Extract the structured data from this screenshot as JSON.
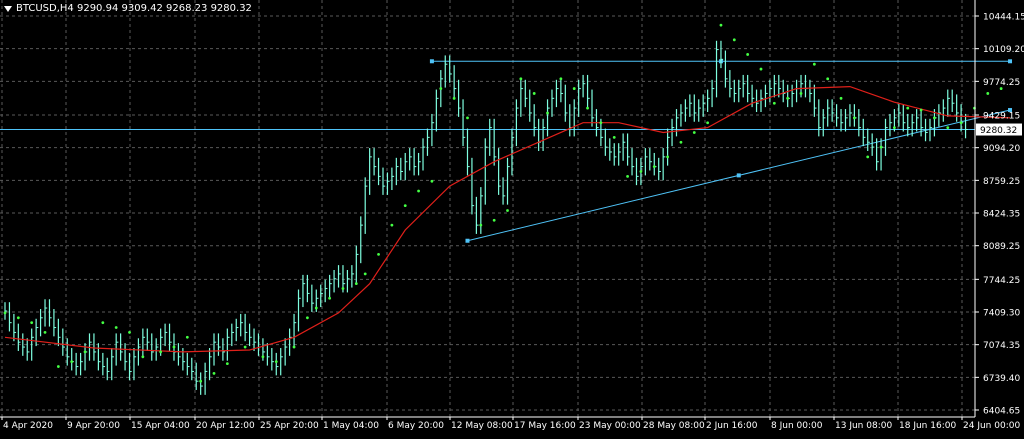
{
  "header": {
    "symbol_line": "BTCUSD,H4  9290.94 9309.42 9268.23 9280.32"
  },
  "colors": {
    "background": "#000000",
    "grid": "#5a5a5a",
    "candles": "#7fffe0",
    "moving_average": "#e0201a",
    "parabolic_sar": "#44ff44",
    "trendline": "#4fc3f7",
    "price_line": "#4fc3f7",
    "axis_text": "#ffffff"
  },
  "chart_data": {
    "type": "line",
    "title": "",
    "symbol": "BTCUSD",
    "timeframe": "H4",
    "ohlc_last": {
      "open": 9290.94,
      "high": 9309.42,
      "low": 9268.23,
      "close": 9280.32
    },
    "current_price_label": "9280.32",
    "ylim": [
      6404.65,
      10600
    ],
    "y_ticks": [
      "10444.15",
      "10109.20",
      "9774.25",
      "9429.15",
      "9094.20",
      "8759.25",
      "8424.35",
      "8089.25",
      "7744.25",
      "7409.30",
      "7074.35",
      "6739.40",
      "6404.65"
    ],
    "x_ticks": [
      "4 Apr 2020",
      "9 Apr 20:00",
      "15 Apr 04:00",
      "20 Apr 12:00",
      "25 Apr 20:00",
      "1 May 04:00",
      "6 May 20:00",
      "12 May 08:00",
      "17 May 16:00",
      "23 May 00:00",
      "28 May 08:00",
      "2 Jun 16:00",
      "8 Jun 00:00",
      "13 Jun 08:00",
      "18 Jun 16:00",
      "24 Jun 00:00"
    ],
    "price_close": [
      7420,
      7300,
      7200,
      7100,
      7050,
      7000,
      7150,
      7250,
      7350,
      7450,
      7350,
      7250,
      7150,
      7050,
      6950,
      6900,
      6850,
      6900,
      7000,
      7100,
      7000,
      6900,
      6850,
      6800,
      6950,
      7100,
      7000,
      6900,
      6800,
      6950,
      7050,
      7150,
      7100,
      7000,
      7050,
      7150,
      7200,
      7100,
      7000,
      6950,
      6900,
      6850,
      6800,
      6700,
      6650,
      6800,
      6950,
      7100,
      7050,
      7000,
      7150,
      7200,
      7250,
      7300,
      7200,
      7150,
      7100,
      7050,
      7000,
      6950,
      6900,
      6850,
      6950,
      7050,
      7150,
      7300,
      7550,
      7700,
      7600,
      7500,
      7550,
      7600,
      7650,
      7700,
      7750,
      7800,
      7700,
      7750,
      7800,
      8000,
      8300,
      8700,
      9000,
      8900,
      8800,
      8700,
      8750,
      8800,
      8900,
      8850,
      8950,
      9000,
      8900,
      8950,
      9100,
      9200,
      9350,
      9600,
      9800,
      9950,
      9850,
      9700,
      9500,
      9200,
      8900,
      8500,
      8300,
      8600,
      9100,
      9300,
      9000,
      8700,
      8600,
      8900,
      9200,
      9500,
      9700,
      9600,
      9450,
      9300,
      9150,
      9300,
      9500,
      9600,
      9700,
      9650,
      9450,
      9300,
      9500,
      9700,
      9750,
      9600,
      9400,
      9300,
      9200,
      9100,
      9050,
      9000,
      9050,
      9150,
      9000,
      8900,
      8800,
      8900,
      9000,
      8950,
      8900,
      8850,
      9000,
      9200,
      9300,
      9400,
      9450,
      9500,
      9550,
      9450,
      9500,
      9550,
      9600,
      9700,
      10100,
      10000,
      9800,
      9700,
      9650,
      9700,
      9750,
      9650,
      9600,
      9550,
      9600,
      9650,
      9700,
      9750,
      9700,
      9650,
      9600,
      9650,
      9700,
      9750,
      9700,
      9650,
      9500,
      9300,
      9400,
      9500,
      9450,
      9400,
      9350,
      9400,
      9450,
      9400,
      9300,
      9200,
      9150,
      9100,
      8950,
      9100,
      9300,
      9350,
      9400,
      9450,
      9350,
      9300,
      9350,
      9400,
      9300,
      9250,
      9300,
      9400,
      9450,
      9500,
      9600,
      9550,
      9450,
      9350,
      9280.32
    ],
    "moving_average": {
      "name": "",
      "values": [
        [
          0,
          7150
        ],
        [
          20,
          7040
        ],
        [
          40,
          7000
        ],
        [
          55,
          7020
        ],
        [
          65,
          7150
        ],
        [
          75,
          7400
        ],
        [
          82,
          7700
        ],
        [
          90,
          8250
        ],
        [
          100,
          8700
        ],
        [
          110,
          8950
        ],
        [
          120,
          9150
        ],
        [
          130,
          9350
        ],
        [
          138,
          9350
        ],
        [
          148,
          9250
        ],
        [
          158,
          9300
        ],
        [
          168,
          9550
        ],
        [
          178,
          9700
        ],
        [
          190,
          9720
        ],
        [
          200,
          9560
        ],
        [
          212,
          9420
        ],
        [
          226,
          9400
        ]
      ]
    },
    "parabolic_sar": {
      "name": "",
      "values": [
        [
          0,
          7400
        ],
        [
          3,
          7350
        ],
        [
          6,
          7300
        ],
        [
          9,
          7200
        ],
        [
          12,
          6850
        ],
        [
          15,
          6900
        ],
        [
          18,
          7000
        ],
        [
          22,
          7300
        ],
        [
          25,
          7250
        ],
        [
          28,
          7200
        ],
        [
          31,
          6950
        ],
        [
          35,
          7000
        ],
        [
          38,
          7050
        ],
        [
          41,
          7150
        ],
        [
          44,
          6700
        ],
        [
          47,
          6780
        ],
        [
          50,
          6880
        ],
        [
          54,
          7050
        ],
        [
          58,
          6950
        ],
        [
          61,
          6900
        ],
        [
          65,
          7050
        ],
        [
          68,
          7350
        ],
        [
          70,
          7450
        ],
        [
          73,
          7550
        ],
        [
          76,
          7650
        ],
        [
          79,
          7700
        ],
        [
          81,
          7800
        ],
        [
          84,
          8000
        ],
        [
          87,
          8300
        ],
        [
          90,
          8500
        ],
        [
          93,
          8650
        ],
        [
          96,
          8750
        ],
        [
          98,
          9700
        ],
        [
          101,
          9600
        ],
        [
          104,
          9400
        ],
        [
          107,
          8300
        ],
        [
          110,
          8350
        ],
        [
          113,
          8450
        ],
        [
          116,
          9800
        ],
        [
          119,
          9650
        ],
        [
          122,
          9450
        ],
        [
          125,
          9800
        ],
        [
          128,
          9700
        ],
        [
          131,
          9500
        ],
        [
          134,
          9350
        ],
        [
          137,
          9200
        ],
        [
          140,
          8800
        ],
        [
          143,
          8850
        ],
        [
          146,
          8900
        ],
        [
          149,
          9000
        ],
        [
          152,
          9150
        ],
        [
          155,
          9250
        ],
        [
          158,
          9350
        ],
        [
          161,
          10350
        ],
        [
          164,
          10200
        ],
        [
          167,
          10050
        ],
        [
          170,
          9900
        ],
        [
          173,
          9550
        ],
        [
          176,
          9600
        ],
        [
          179,
          9650
        ],
        [
          182,
          9950
        ],
        [
          185,
          9800
        ],
        [
          188,
          9600
        ],
        [
          191,
          9400
        ],
        [
          194,
          9000
        ],
        [
          197,
          9100
        ],
        [
          200,
          9300
        ],
        [
          203,
          9500
        ],
        [
          206,
          9480
        ],
        [
          209,
          9400
        ],
        [
          212,
          9300
        ],
        [
          215,
          9350
        ],
        [
          218,
          9500
        ],
        [
          221,
          9650
        ],
        [
          224,
          9700
        ]
      ]
    },
    "trendlines": [
      {
        "name": "",
        "type": "horizontal_resistance",
        "from": [
          96,
          9980
        ],
        "to": [
          226,
          9980
        ]
      },
      {
        "name": "",
        "type": "rising_support",
        "from": [
          104,
          8140
        ],
        "to": [
          226,
          9480
        ]
      }
    ],
    "grid": true,
    "y_axis_position": "right",
    "x_axis_position": "bottom"
  }
}
